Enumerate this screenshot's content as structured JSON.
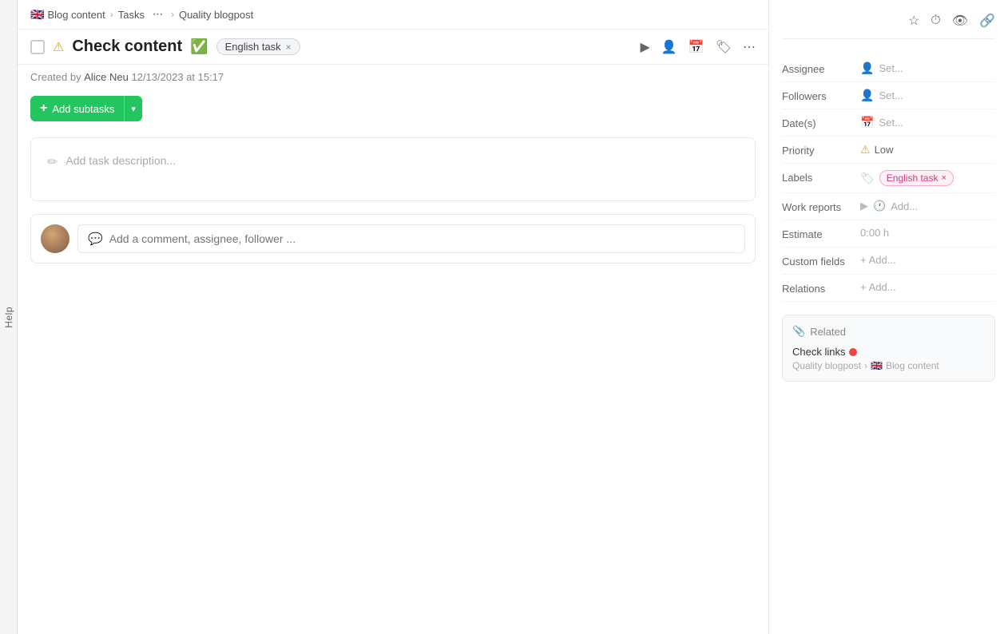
{
  "help_tab": {
    "label": "Help"
  },
  "breadcrumb": {
    "items": [
      {
        "id": "blog-content",
        "label": "Blog content",
        "flag": "🇬🇧"
      },
      {
        "id": "tasks",
        "label": "Tasks"
      },
      {
        "id": "quality-blogpost",
        "label": "Quality blogpost"
      }
    ]
  },
  "task": {
    "title": "Check content",
    "completed": true,
    "warning": true,
    "tag": "English task",
    "meta": {
      "created_by_label": "Created by",
      "author": "Alice Neu",
      "date": "12/13/2023 at 15:17"
    },
    "add_subtasks_label": "Add subtasks",
    "description_placeholder": "Add task description...",
    "comment_placeholder": "Add a comment, assignee, follower ..."
  },
  "header_actions": {
    "play_icon": "▶",
    "user_icon": "👤",
    "calendar_icon": "📅",
    "tag_icon": "🏷",
    "more_icon": "⋯"
  },
  "sidebar": {
    "star_icon": "☆",
    "timer_icon": "⏱",
    "eye_icon": "👁",
    "link_icon": "🔗",
    "fields": {
      "assignee": {
        "label": "Assignee",
        "value": "Set...",
        "icon": "👤"
      },
      "followers": {
        "label": "Followers",
        "value": "Set...",
        "icon": "👤"
      },
      "dates": {
        "label": "Date(s)",
        "value": "Set...",
        "icon": "📅"
      },
      "priority": {
        "label": "Priority",
        "value": "Low",
        "icon": "⚠"
      },
      "labels": {
        "label": "Labels",
        "tag": "English task"
      },
      "work_reports": {
        "label": "Work reports",
        "add_label": "Add..."
      },
      "estimate": {
        "label": "Estimate",
        "value": "0:00 h"
      },
      "custom_fields": {
        "label": "Custom fields",
        "add_label": "Add..."
      },
      "relations": {
        "label": "Relations",
        "add_label": "Add..."
      }
    },
    "related": {
      "section_label": "Related",
      "link_title": "Check links",
      "link_path": "Quality blogpost",
      "link_project": "Blog content",
      "flag": "🇬🇧"
    }
  }
}
